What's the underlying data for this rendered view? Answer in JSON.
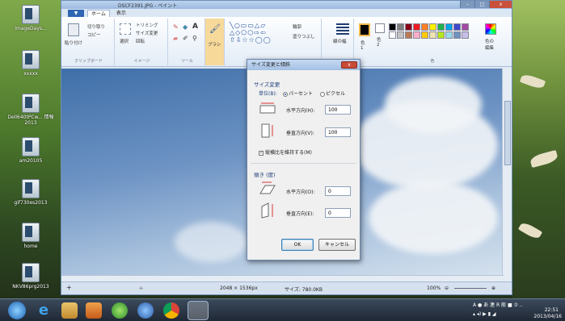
{
  "desktop": {
    "icons": [
      {
        "label": "ImageDays..."
      },
      {
        "label": "xxxxx"
      },
      {
        "label": "Dell640tPCw...\n情報2013"
      },
      {
        "label": "am20105"
      },
      {
        "label": "gif730es2013"
      },
      {
        "label": "home"
      },
      {
        "label": "NKV86prg2013"
      }
    ]
  },
  "paint": {
    "window_title": "DSCF2391.JPG - ペイント",
    "tabs": {
      "file": "▼",
      "home": "ホーム",
      "view": "表示"
    },
    "ribbon": {
      "paste": "貼り付け",
      "cut": "切り取り",
      "copy": "コピー",
      "clipboard_group": "クリップボード",
      "select": "選択",
      "crop": "トリミング",
      "resize": "サイズ変更",
      "rotate": "回転",
      "image_group": "イメージ",
      "tools_group": "ツール",
      "brush": "ブラシ",
      "outline": "輪郭",
      "fill": "塗りつぶし",
      "size": "線の幅",
      "color1": "色\n1",
      "color2": "色\n2",
      "edit_colors": "色の\n編集",
      "colors_group": "色"
    },
    "palette": [
      "#000000",
      "#7f7f7f",
      "#880015",
      "#ed1c24",
      "#ff7f27",
      "#fff200",
      "#22b14c",
      "#00a2e8",
      "#3f48cc",
      "#a349a4",
      "#ffffff",
      "#c3c3c3",
      "#b97a57",
      "#ffaec9",
      "#ffc90e",
      "#efe4b0",
      "#b5e61d",
      "#99d9ea",
      "#7092be",
      "#c8bfe7"
    ],
    "status": {
      "dimensions": "2048 × 1536px",
      "size": "サイズ: 780.0KB",
      "zoom": "100%"
    }
  },
  "dialog": {
    "title": "サイズ変更と傾斜",
    "close": "x",
    "resize_section": "サイズ変更",
    "unit_label": "単位(B):",
    "percent": "パーセント",
    "pixel": "ピクセル",
    "horizontal_label": "水平方向(H):",
    "horizontal_value": "100",
    "vertical_label": "垂直方向(V):",
    "vertical_value": "100",
    "keep_ratio": "縦横比を維持する(M)",
    "skew_section": "傾き (度)",
    "skew_h_label": "水平方向(O):",
    "skew_h_value": "0",
    "skew_v_label": "垂直方向(E):",
    "skew_v_value": "0",
    "ok": "OK",
    "cancel": "キャンセル"
  },
  "taskbar": {
    "time": "22:51",
    "date": "2013/04/16",
    "tray_text": "A ● あ 連 R 般 ■ ⑦ .."
  }
}
